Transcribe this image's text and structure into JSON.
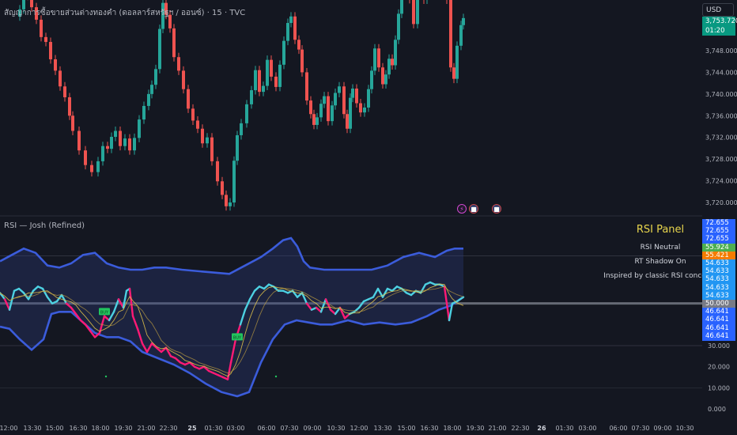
{
  "header": {
    "title": "สัญญาการซื้อขายส่วนต่างทองคำ (ดอลลาร์สหรัฐฯ / ออนซ์) · 15 · TVC",
    "currency": "USD",
    "price_tag": "3,753.720",
    "countdown": "01:20"
  },
  "price_axis": {
    "labels": [
      "3,748.000",
      "3,744.000",
      "3,740.000",
      "3,736.000",
      "3,732.000",
      "3,728.000",
      "3,724.000",
      "3,720.000"
    ],
    "values": [
      3748,
      3744,
      3740,
      3736,
      3732,
      3728,
      3724,
      3720
    ]
  },
  "indicator": {
    "label": "RSI  — Josh (Refined)",
    "axis_labels": [
      "30.000",
      "20.000",
      "10.000",
      "0.000"
    ],
    "axis_values": [
      30,
      20,
      10,
      0
    ],
    "tags": [
      {
        "text": "72.655",
        "value": 72.655,
        "color": "#2962ff"
      },
      {
        "text": "72.655",
        "value": 72.655,
        "color": "#2962ff"
      },
      {
        "text": "72.655",
        "value": 72.655,
        "color": "#2962ff"
      },
      {
        "text": "55.924",
        "value": 55.924,
        "color": "#4caf50"
      },
      {
        "text": "55.421",
        "value": 55.421,
        "color": "#f57c00"
      },
      {
        "text": "54.633",
        "value": 54.633,
        "color": "#2196f3"
      },
      {
        "text": "54.633",
        "value": 54.633,
        "color": "#2196f3"
      },
      {
        "text": "54.633",
        "value": 54.633,
        "color": "#2196f3"
      },
      {
        "text": "54.633",
        "value": 54.633,
        "color": "#2196f3"
      },
      {
        "text": "54.633",
        "value": 54.633,
        "color": "#2196f3"
      },
      {
        "text": "50.000",
        "value": 50.0,
        "color": "#787b86"
      },
      {
        "text": "46.641",
        "value": 46.641,
        "color": "#2962ff"
      },
      {
        "text": "46.641",
        "value": 46.641,
        "color": "#2962ff"
      },
      {
        "text": "46.641",
        "value": 46.641,
        "color": "#2962ff"
      },
      {
        "text": "46.641",
        "value": 46.641,
        "color": "#2962ff"
      }
    ],
    "signals": [
      {
        "text": "BUY"
      },
      {
        "text": "BUY"
      }
    ]
  },
  "panel": {
    "title": "RSI Panel",
    "lines": [
      "RSI Neutral",
      "RT Shadow On",
      "Inspired by classic RSI concepts"
    ]
  },
  "time_axis": {
    "labels": [
      "12:00",
      "13:30",
      "15:00",
      "16:30",
      "18:00",
      "19:30",
      "21:00",
      "22:30",
      "25",
      "01:30",
      "03:00",
      "06:00",
      "07:30",
      "09:00",
      "10:30",
      "12:00",
      "13:30",
      "15:00",
      "16:30",
      "18:00",
      "19:30",
      "21:00",
      "22:30",
      "26",
      "01:30",
      "03:00",
      "06:00",
      "07:30",
      "09:00",
      "10:30"
    ]
  },
  "events": [
    {
      "icon": "lightning-icon"
    },
    {
      "icon": "us-flag-icon"
    },
    {
      "icon": "us-flag-icon"
    }
  ],
  "colors": {
    "bull": "#26a69a",
    "bear": "#ef5350",
    "rsi_up": "#4dd0e1",
    "rsi_down": "#ff1a75",
    "band": "#3b5cdb",
    "price_tag": "#089981"
  }
}
